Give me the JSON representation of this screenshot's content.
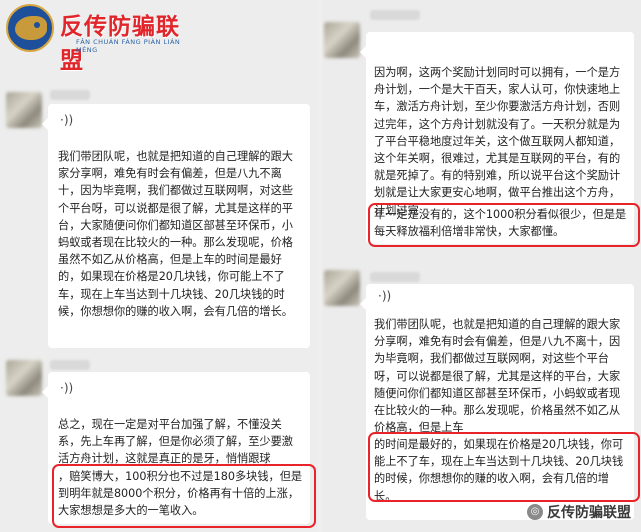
{
  "logo": {
    "title": "反传防骗联盟",
    "subtitle": "FǍN CHUÁN FÁNG PIÀN LIÁN MÉNG"
  },
  "voice_icon": "voice-message-icon",
  "left": {
    "bubble1": "我们带团队呢，也就是把知道的自己理解的跟大家分享啊，难免有时会有偏差，但是八九不离十，因为毕竟啊，我们都做过互联网啊，对这些个平台呀，可以说都是很了解，尤其是这样的平台，大家随便问你们都知道区部甚至环保币，小蚂蚁或者现在比较火的一种。那么发现呢，价格虽然不如乙从价格高，但是上车的时间是最好的，如果现在价格是20几块钱，你可能上不了车，现在上车当达到十几块钱、20几块钱的时候，你想想你的赚的收入啊，会有几倍的增长。",
    "bubble2_a": "总之，现在一定是对平台加强了解，不懂没关系，先上车再了解，但是你必须了解，至少要激活方舟计划，这就是真正的是牙，悄悄跟球",
    "bubble2_b": "，赔笑博大，100积分也不过是180多块钱，但是到明年就是8000个积分，价格再有十倍的上涨，大家想想是多大的一笔收入。"
  },
  "right": {
    "bubble1_a": "因为啊，这两个奖励计划同时可以拥有，一个是方舟计划，一个是大干百天，家人认可，你快速地上车，激活方舟计划，至少你要激活方舟计划，否则过完年，这个方舟计划就没有了。一天积分就是为了平台平稳地度过年关，这个做互联网人都知道，这个年关啊，很难过，尤其是互联网的平台，有的就是死掉了。有的特别难，所以说平台这个奖励计划就是让大家更安心地啊，做平台推出这个方舟，计划过完",
    "bubble1_b": "年一定是没有的，这个1000积分看似很少，但是是每天释放福利倍增非常快，大家都懂。",
    "bubble2_a": "我们带团队呢，也就是把知道的自己理解的跟大家分享啊，难免有时会有偏差，但是八九不离十，因为毕竟啊，我们都做过互联网啊，对这些个平台呀，可以说都是很了解，尤其是这样的平台，大家随便问你们都知道区部甚至环保币，小蚂蚁或者现在比较火的一种。那么发现呢，价格虽然不如乙从价格高，但是上车",
    "bubble2_b": "的时间是最好的，如果现在价格是20几块钱，你可能上不了车，现在上车当达到十几块钱、20几块钱的时候，你想想你的赚的收入啊，会有几倍的增长。"
  },
  "watermark": "反传防骗联盟"
}
